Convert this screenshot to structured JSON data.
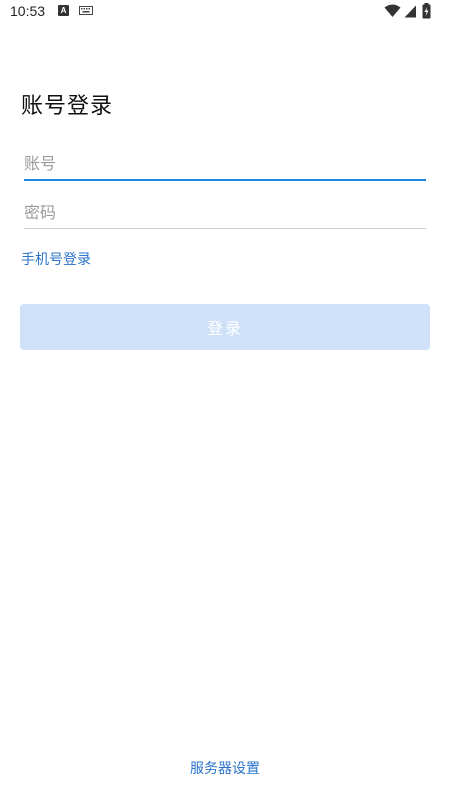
{
  "status_bar": {
    "time": "10:53",
    "notification_icon_letter": "A",
    "icons": [
      "notification-a-icon",
      "keyboard-icon",
      "wifi-icon",
      "signal-icon",
      "battery-icon"
    ]
  },
  "login": {
    "title": "账号登录",
    "account_placeholder": "账号",
    "account_value": "",
    "password_placeholder": "密码",
    "password_value": "",
    "phone_login_link": "手机号登录",
    "login_button": "登录",
    "server_settings_link": "服务器设置"
  },
  "colors": {
    "accent": "#1e88e5",
    "link": "#2a74c9",
    "button_disabled": "#cfe0f9"
  }
}
